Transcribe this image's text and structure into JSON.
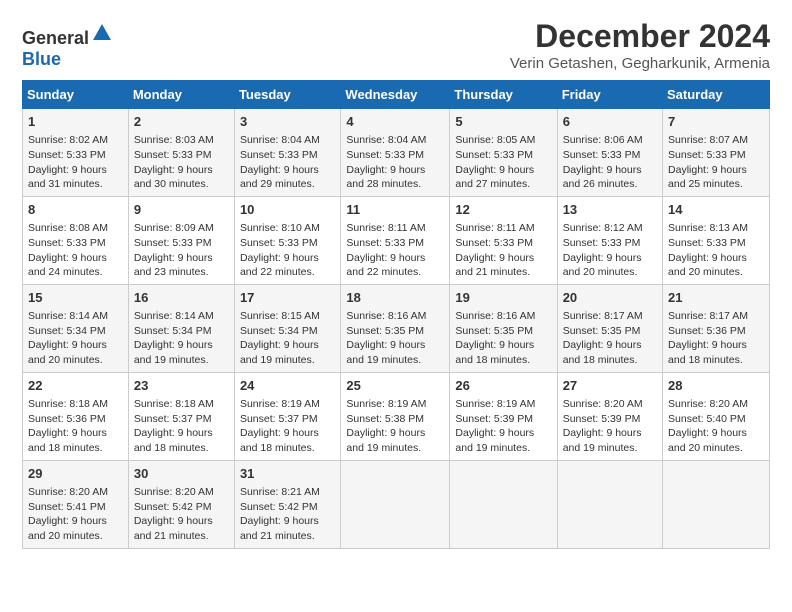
{
  "header": {
    "logo_general": "General",
    "logo_blue": "Blue",
    "title": "December 2024",
    "subtitle": "Verin Getashen, Gegharkunik, Armenia"
  },
  "weekdays": [
    "Sunday",
    "Monday",
    "Tuesday",
    "Wednesday",
    "Thursday",
    "Friday",
    "Saturday"
  ],
  "weeks": [
    [
      {
        "day": "1",
        "lines": [
          "Sunrise: 8:02 AM",
          "Sunset: 5:33 PM",
          "Daylight: 9 hours",
          "and 31 minutes."
        ]
      },
      {
        "day": "2",
        "lines": [
          "Sunrise: 8:03 AM",
          "Sunset: 5:33 PM",
          "Daylight: 9 hours",
          "and 30 minutes."
        ]
      },
      {
        "day": "3",
        "lines": [
          "Sunrise: 8:04 AM",
          "Sunset: 5:33 PM",
          "Daylight: 9 hours",
          "and 29 minutes."
        ]
      },
      {
        "day": "4",
        "lines": [
          "Sunrise: 8:04 AM",
          "Sunset: 5:33 PM",
          "Daylight: 9 hours",
          "and 28 minutes."
        ]
      },
      {
        "day": "5",
        "lines": [
          "Sunrise: 8:05 AM",
          "Sunset: 5:33 PM",
          "Daylight: 9 hours",
          "and 27 minutes."
        ]
      },
      {
        "day": "6",
        "lines": [
          "Sunrise: 8:06 AM",
          "Sunset: 5:33 PM",
          "Daylight: 9 hours",
          "and 26 minutes."
        ]
      },
      {
        "day": "7",
        "lines": [
          "Sunrise: 8:07 AM",
          "Sunset: 5:33 PM",
          "Daylight: 9 hours",
          "and 25 minutes."
        ]
      }
    ],
    [
      {
        "day": "8",
        "lines": [
          "Sunrise: 8:08 AM",
          "Sunset: 5:33 PM",
          "Daylight: 9 hours",
          "and 24 minutes."
        ]
      },
      {
        "day": "9",
        "lines": [
          "Sunrise: 8:09 AM",
          "Sunset: 5:33 PM",
          "Daylight: 9 hours",
          "and 23 minutes."
        ]
      },
      {
        "day": "10",
        "lines": [
          "Sunrise: 8:10 AM",
          "Sunset: 5:33 PM",
          "Daylight: 9 hours",
          "and 22 minutes."
        ]
      },
      {
        "day": "11",
        "lines": [
          "Sunrise: 8:11 AM",
          "Sunset: 5:33 PM",
          "Daylight: 9 hours",
          "and 22 minutes."
        ]
      },
      {
        "day": "12",
        "lines": [
          "Sunrise: 8:11 AM",
          "Sunset: 5:33 PM",
          "Daylight: 9 hours",
          "and 21 minutes."
        ]
      },
      {
        "day": "13",
        "lines": [
          "Sunrise: 8:12 AM",
          "Sunset: 5:33 PM",
          "Daylight: 9 hours",
          "and 20 minutes."
        ]
      },
      {
        "day": "14",
        "lines": [
          "Sunrise: 8:13 AM",
          "Sunset: 5:33 PM",
          "Daylight: 9 hours",
          "and 20 minutes."
        ]
      }
    ],
    [
      {
        "day": "15",
        "lines": [
          "Sunrise: 8:14 AM",
          "Sunset: 5:34 PM",
          "Daylight: 9 hours",
          "and 20 minutes."
        ]
      },
      {
        "day": "16",
        "lines": [
          "Sunrise: 8:14 AM",
          "Sunset: 5:34 PM",
          "Daylight: 9 hours",
          "and 19 minutes."
        ]
      },
      {
        "day": "17",
        "lines": [
          "Sunrise: 8:15 AM",
          "Sunset: 5:34 PM",
          "Daylight: 9 hours",
          "and 19 minutes."
        ]
      },
      {
        "day": "18",
        "lines": [
          "Sunrise: 8:16 AM",
          "Sunset: 5:35 PM",
          "Daylight: 9 hours",
          "and 19 minutes."
        ]
      },
      {
        "day": "19",
        "lines": [
          "Sunrise: 8:16 AM",
          "Sunset: 5:35 PM",
          "Daylight: 9 hours",
          "and 18 minutes."
        ]
      },
      {
        "day": "20",
        "lines": [
          "Sunrise: 8:17 AM",
          "Sunset: 5:35 PM",
          "Daylight: 9 hours",
          "and 18 minutes."
        ]
      },
      {
        "day": "21",
        "lines": [
          "Sunrise: 8:17 AM",
          "Sunset: 5:36 PM",
          "Daylight: 9 hours",
          "and 18 minutes."
        ]
      }
    ],
    [
      {
        "day": "22",
        "lines": [
          "Sunrise: 8:18 AM",
          "Sunset: 5:36 PM",
          "Daylight: 9 hours",
          "and 18 minutes."
        ]
      },
      {
        "day": "23",
        "lines": [
          "Sunrise: 8:18 AM",
          "Sunset: 5:37 PM",
          "Daylight: 9 hours",
          "and 18 minutes."
        ]
      },
      {
        "day": "24",
        "lines": [
          "Sunrise: 8:19 AM",
          "Sunset: 5:37 PM",
          "Daylight: 9 hours",
          "and 18 minutes."
        ]
      },
      {
        "day": "25",
        "lines": [
          "Sunrise: 8:19 AM",
          "Sunset: 5:38 PM",
          "Daylight: 9 hours",
          "and 19 minutes."
        ]
      },
      {
        "day": "26",
        "lines": [
          "Sunrise: 8:19 AM",
          "Sunset: 5:39 PM",
          "Daylight: 9 hours",
          "and 19 minutes."
        ]
      },
      {
        "day": "27",
        "lines": [
          "Sunrise: 8:20 AM",
          "Sunset: 5:39 PM",
          "Daylight: 9 hours",
          "and 19 minutes."
        ]
      },
      {
        "day": "28",
        "lines": [
          "Sunrise: 8:20 AM",
          "Sunset: 5:40 PM",
          "Daylight: 9 hours",
          "and 20 minutes."
        ]
      }
    ],
    [
      {
        "day": "29",
        "lines": [
          "Sunrise: 8:20 AM",
          "Sunset: 5:41 PM",
          "Daylight: 9 hours",
          "and 20 minutes."
        ]
      },
      {
        "day": "30",
        "lines": [
          "Sunrise: 8:20 AM",
          "Sunset: 5:42 PM",
          "Daylight: 9 hours",
          "and 21 minutes."
        ]
      },
      {
        "day": "31",
        "lines": [
          "Sunrise: 8:21 AM",
          "Sunset: 5:42 PM",
          "Daylight: 9 hours",
          "and 21 minutes."
        ]
      },
      null,
      null,
      null,
      null
    ]
  ]
}
